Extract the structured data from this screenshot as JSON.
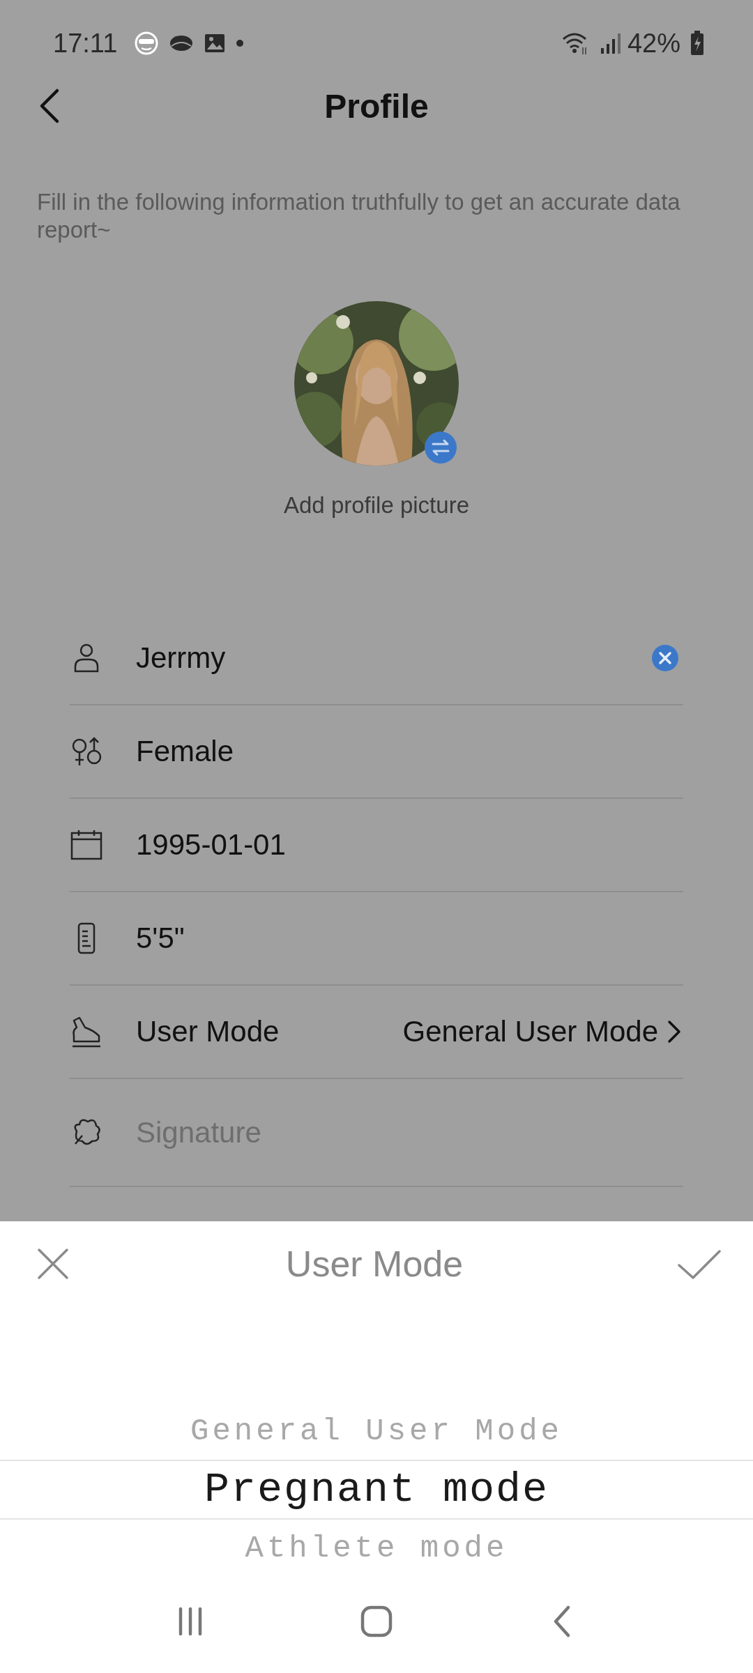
{
  "status_bar": {
    "time": "17:11",
    "battery": "42%"
  },
  "header": {
    "title": "Profile"
  },
  "description": "Fill in the following information truthfully to get an accurate data report~",
  "avatar": {
    "caption": "Add profile picture"
  },
  "fields": [
    {
      "kind": "name",
      "value": "Jerrmy"
    },
    {
      "kind": "gender",
      "value": "Female"
    },
    {
      "kind": "birthday",
      "value": "1995-01-01"
    },
    {
      "kind": "height",
      "value": "5'5\""
    },
    {
      "kind": "user_mode",
      "label": "User Mode",
      "value": "General User Mode"
    },
    {
      "kind": "signature",
      "placeholder": "Signature"
    }
  ],
  "sheet": {
    "title": "User Mode",
    "options": [
      {
        "label": "General User Mode",
        "selected": false
      },
      {
        "label": "Pregnant mode",
        "selected": true
      },
      {
        "label": "Athlete mode",
        "selected": false
      }
    ]
  }
}
